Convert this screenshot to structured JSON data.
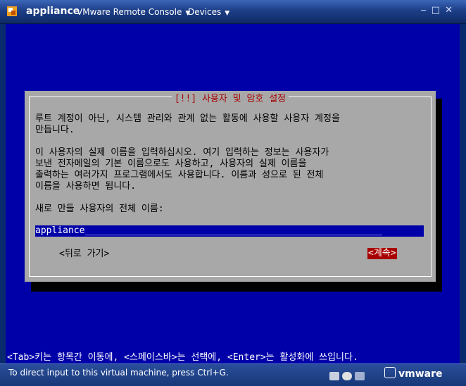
{
  "window": {
    "app_name": "appliance",
    "menus": [
      {
        "label": "VMware Remote Console"
      },
      {
        "label": "Devices"
      }
    ],
    "controls": {
      "minimize": "‒",
      "maximize": "□",
      "close": "✕"
    }
  },
  "dialog": {
    "title": "[!!] 사용자 및 암호 설정",
    "paragraph1": "루트 계정이 아닌, 시스템 관리와 관계 없는 활동에 사용할 사용자 계정을\n만듭니다.",
    "paragraph2": "이 사용자의 실제 이름을 입력하십시오. 여기 입력하는 정보는 사용자가\n보낸 전자메일의 기본 이름으로도 사용하고, 사용자의 실제 이름을\n출력하는 여러가지 프로그램에서도 사용합니다. 이름과 성으로 된 전체\n이름을 사용하면 됩니다.",
    "prompt": "새로 만들 사용자의 전체 이름:",
    "input_value": "appliance",
    "input_fill": "______________________________________________________",
    "back_button": "<뒤로 가기>",
    "continue_button": "<계속>"
  },
  "help_line": "<Tab>키는 항목간 이동에, <스페이스바>는 선택에, <Enter>는 활성화에 쓰입니다.",
  "status_bar": {
    "message": "To direct input to this virtual machine, press Ctrl+G.",
    "brand": "vmware"
  },
  "colors": {
    "console_bg": "#0000a8",
    "dialog_bg": "#a8a8a8",
    "title_red": "#a80000",
    "selected_button_bg": "#a80000"
  }
}
